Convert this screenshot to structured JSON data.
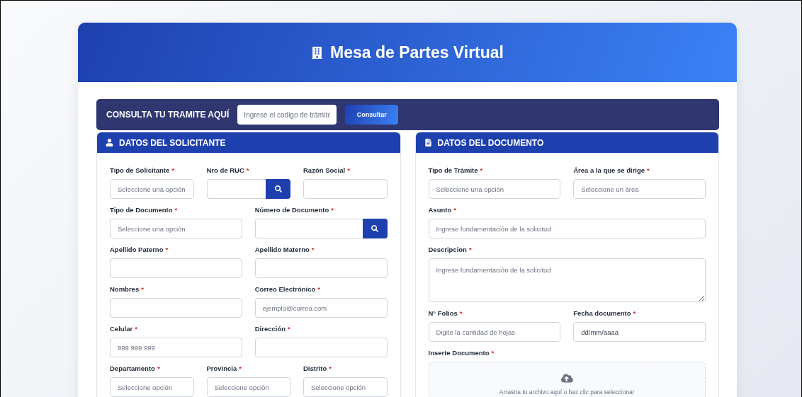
{
  "header": {
    "title": "Mesa de Partes Virtual"
  },
  "consulta": {
    "label": "CONSULTA TU TRAMITE AQUÍ",
    "placeholder": "Ingrese el codigo de trámite",
    "button": "Consultar"
  },
  "panels": [
    {
      "kind": "person",
      "title": "DATOS DEL SOLICITANTE",
      "rows": [
        [
          {
            "label": "Tipo de Solicitante",
            "mark": "*",
            "kind": "select",
            "placeholder": "Seleccione una opción"
          },
          {
            "label": "Nro de RUC",
            "mark": "*",
            "kind": "search"
          },
          {
            "label": "Razón Social",
            "mark": "*",
            "kind": "input"
          }
        ],
        [
          {
            "label": "Tipo de Documento",
            "mark": "*",
            "kind": "select",
            "placeholder": "Seleccione una opción"
          },
          {
            "label": "Número de Documento",
            "mark": "*",
            "kind": "search"
          }
        ],
        [
          {
            "label": "Apellido Paterno",
            "mark": "*",
            "kind": "input"
          },
          {
            "label": "Apellido Materno",
            "mark": "*",
            "kind": "input"
          }
        ],
        [
          {
            "label": "Nombres",
            "mark": "*",
            "kind": "input"
          },
          {
            "label": "Correo Electrónico",
            "mark": "*",
            "kind": "input",
            "placeholder": "ejemplo@correo.com"
          }
        ],
        [
          {
            "label": "Celular",
            "mark": "*",
            "kind": "input",
            "placeholder": "999 999 999"
          },
          {
            "label": "Dirección",
            "mark": "*",
            "kind": "input"
          }
        ],
        [
          {
            "label": "Departamento",
            "mark": "*",
            "kind": "select",
            "placeholder": "Seleccione opción"
          },
          {
            "label": "Provincia",
            "mark": "*",
            "kind": "select",
            "placeholder": "Seleccione opción"
          },
          {
            "label": "Distrito",
            "mark": "*",
            "kind": "select",
            "placeholder": "Seleccione opción"
          }
        ]
      ]
    },
    {
      "kind": "document",
      "title": "DATOS DEL DOCUMENTO",
      "rows": [
        [
          {
            "label": "Tipo de Trámite",
            "mark": "*",
            "kind": "select",
            "placeholder": "Seleccione una opción"
          },
          {
            "label": "Área a la que se dirige",
            "mark": "*",
            "kind": "select",
            "placeholder": "Seleccione un área"
          }
        ],
        [
          {
            "label": "Asunto",
            "mark": "*",
            "kind": "input",
            "placeholder": "Ingrese fundamentación de la solicitud"
          }
        ],
        [
          {
            "label": "Descripcion",
            "mark": "*",
            "kind": "textarea",
            "placeholder": "Ingrese fundamentación de la solicitud"
          }
        ],
        [
          {
            "label": "N° Folios",
            "mark": "*",
            "kind": "input",
            "placeholder": "Digite la cantidad de hojas"
          },
          {
            "label": "Fecha documento",
            "mark": "*",
            "kind": "date",
            "value": "dd/mm/aaaa"
          }
        ],
        [
          {
            "label": "Inserte Documento",
            "mark": "*",
            "kind": "upload",
            "text": "Arrastra tu archivo aquí o haz clic para seleccionar"
          }
        ]
      ]
    }
  ]
}
